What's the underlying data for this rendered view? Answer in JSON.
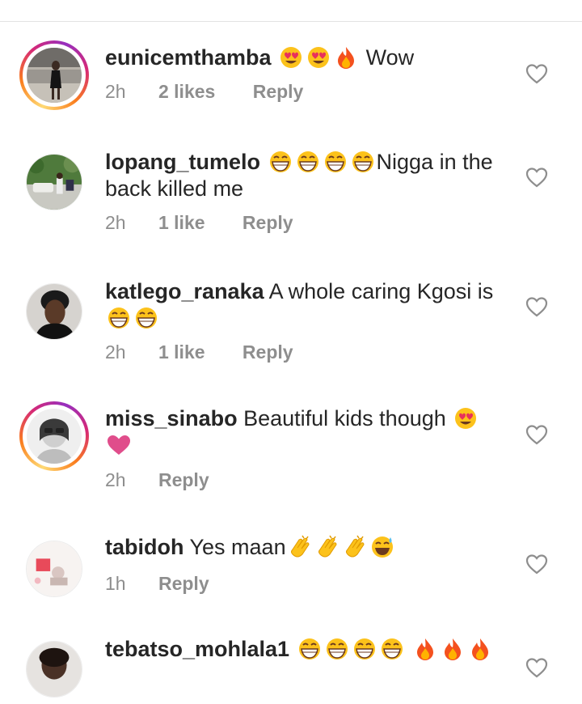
{
  "comments": [
    {
      "username": "eunicemthamba",
      "text_before": "",
      "emojis": [
        "heart-eyes-emoji",
        "heart-eyes-emoji",
        "fire-emoji"
      ],
      "text_after": " Wow",
      "time": "2h",
      "likes": "2 likes",
      "reply": "Reply",
      "has_story_ring": true
    },
    {
      "username": "lopang_tumelo",
      "emojis": [
        "grin-emoji",
        "grin-emoji",
        "grin-emoji",
        "grin-emoji"
      ],
      "text_after": "Nigga in the back killed me",
      "time": "2h",
      "likes": "1 like",
      "reply": "Reply",
      "has_story_ring": false
    },
    {
      "username": "katlego_ranaka",
      "text_before": "A whole caring Kgosi is",
      "emojis": [
        "grin-emoji",
        "grin-emoji"
      ],
      "time": "2h",
      "likes": "1 like",
      "reply": "Reply",
      "has_story_ring": false
    },
    {
      "username": "miss_sinabo",
      "text_before": "Beautiful kids though",
      "emojis": [
        "heart-eyes-emoji",
        "pink-heart-emoji"
      ],
      "time": "2h",
      "likes": "",
      "reply": "Reply",
      "has_story_ring": true
    },
    {
      "username": "tabidoh",
      "text_before": "Yes maan",
      "emojis": [
        "clap-emoji",
        "clap-emoji",
        "clap-emoji",
        "sweat-smile-emoji"
      ],
      "time": "1h",
      "likes": "",
      "reply": "Reply",
      "has_story_ring": false
    },
    {
      "username": "tebatso_mohlala1",
      "emojis": [
        "grin-emoji",
        "grin-emoji",
        "grin-emoji",
        "grin-emoji",
        "fire-emoji",
        "fire-emoji",
        "fire-emoji"
      ],
      "has_story_ring": false
    }
  ],
  "icons": {
    "like": "heart-outline-icon"
  },
  "colors": {
    "muted": "#8e8e8e",
    "text": "#262626",
    "divider": "#e3e3e3"
  }
}
